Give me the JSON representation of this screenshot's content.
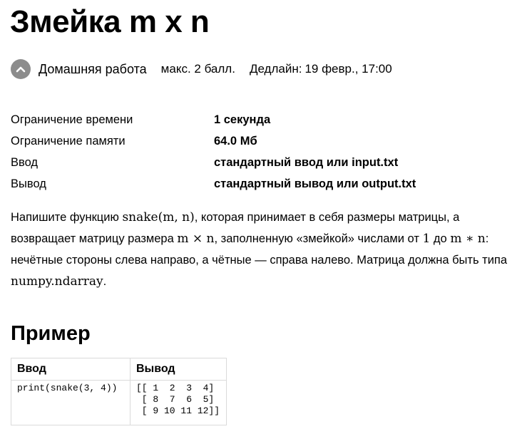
{
  "task": {
    "title": "Змейка m x n",
    "type_label": "Домашняя работа",
    "score_label": "макс. 2 балл.",
    "deadline_label": "Дедлайн:",
    "deadline_value": "19 февр., 17:00",
    "badge_icon": "chevron-up-icon"
  },
  "limits": [
    {
      "label": "Ограничение времени",
      "value": "1 секунда"
    },
    {
      "label": "Ограничение памяти",
      "value": "64.0 Мб"
    },
    {
      "label": "Ввод",
      "value": "стандартный ввод или input.txt"
    },
    {
      "label": "Вывод",
      "value": "стандартный вывод или output.txt"
    }
  ],
  "statement": {
    "p1": "Напишите функцию ",
    "m1": "snake(m, n)",
    "p2": ", которая принимает в себя размеры матрицы, а возвращает матрицу размера ",
    "m2": "m × n",
    "p3": ", заполненную «змейкой» числами от ",
    "m3": "1",
    "p4": " до ",
    "m4": "m ∗ n",
    "p5": ": нечётные стороны слева направо, а чётные — справа налево. Матрица должна быть типа ",
    "m5": "numpy.ndarray",
    "p6": "."
  },
  "example": {
    "section_title": "Пример",
    "input_header": "Ввод",
    "output_header": "Вывод",
    "input": "print(snake(3, 4))",
    "output": "[[ 1  2  3  4]\n [ 8  7  6  5]\n [ 9 10 11 12]]"
  },
  "colors": {
    "badge": "#8c8c8c",
    "table_border": "#dadada"
  }
}
